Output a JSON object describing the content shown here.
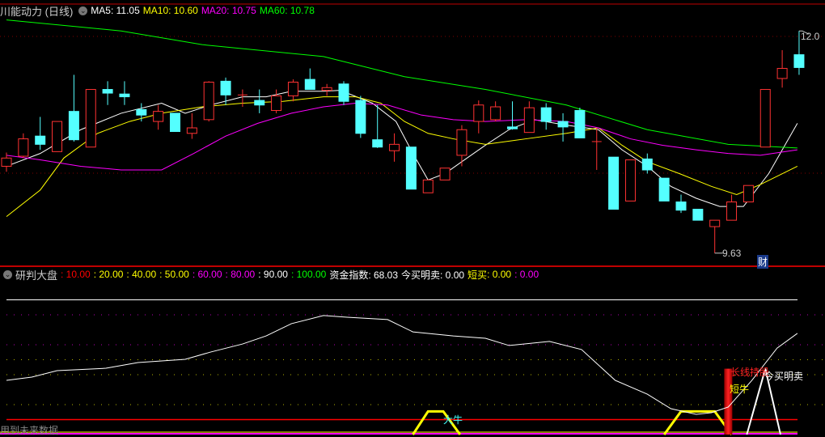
{
  "main_panel": {
    "title": "川能动力 (日线)",
    "ma": [
      {
        "label": "MA5: 11.05",
        "color": "#ffffff"
      },
      {
        "label": "MA10: 10.60",
        "color": "#ffff00"
      },
      {
        "label": "MA20: 10.75",
        "color": "#ff00ff"
      },
      {
        "label": "MA60: 10.78",
        "color": "#00ff00"
      }
    ],
    "high_label": "12.0",
    "low_label": "9.63",
    "finance_marker": "财",
    "colors": {
      "up": "#ff3232",
      "down": "#54ffff",
      "border": "#c00000"
    },
    "candles": [
      [
        10.58,
        10.67,
        10.73,
        10.52
      ],
      [
        10.69,
        10.88,
        10.94,
        10.67
      ],
      [
        10.91,
        10.82,
        11.12,
        10.76
      ],
      [
        10.74,
        11.07,
        11.07,
        10.74
      ],
      [
        11.18,
        10.87,
        11.58,
        10.85
      ],
      [
        10.79,
        11.42,
        11.42,
        10.79
      ],
      [
        11.42,
        11.38,
        11.51,
        11.25
      ],
      [
        11.37,
        11.34,
        11.51,
        11.25
      ],
      [
        11.2,
        11.14,
        11.27,
        11.07
      ],
      [
        11.07,
        11.18,
        11.25,
        10.98
      ],
      [
        11.16,
        10.96,
        11.16,
        10.96
      ],
      [
        10.94,
        11.0,
        11.16,
        10.88
      ],
      [
        11.09,
        11.5,
        11.51,
        11.07
      ],
      [
        11.51,
        11.36,
        11.55,
        11.25
      ],
      [
        11.36,
        11.36,
        11.42,
        11.23
      ],
      [
        11.3,
        11.25,
        11.42,
        11.16
      ],
      [
        11.19,
        11.35,
        11.42,
        11.16
      ],
      [
        11.35,
        11.5,
        11.53,
        11.29
      ],
      [
        11.53,
        11.42,
        11.65,
        11.42
      ],
      [
        11.41,
        11.44,
        11.48,
        11.35
      ],
      [
        11.48,
        11.29,
        11.51,
        11.25
      ],
      [
        11.3,
        10.94,
        11.35,
        10.89
      ],
      [
        10.87,
        10.79,
        11.25,
        10.78
      ],
      [
        10.75,
        10.82,
        10.94,
        10.63
      ],
      [
        10.79,
        10.33,
        10.79,
        10.33
      ],
      [
        10.29,
        10.43,
        10.43,
        10.29
      ],
      [
        10.43,
        10.56,
        10.56,
        10.43
      ],
      [
        10.7,
        10.98,
        11.03,
        10.58
      ],
      [
        11.07,
        11.25,
        11.3,
        10.94
      ],
      [
        11.09,
        11.23,
        11.29,
        11.07
      ],
      [
        11.01,
        10.99,
        11.29,
        10.98
      ],
      [
        10.95,
        11.22,
        11.29,
        10.95
      ],
      [
        11.22,
        11.07,
        11.27,
        10.98
      ],
      [
        11.07,
        11.01,
        11.16,
        10.85
      ],
      [
        11.19,
        10.89,
        11.22,
        10.89
      ],
      [
        10.85,
        10.85,
        11.0,
        10.54
      ],
      [
        10.68,
        10.11,
        10.68,
        10.11
      ],
      [
        10.2,
        10.65,
        10.65,
        10.2
      ],
      [
        10.66,
        10.54,
        10.72,
        10.5
      ],
      [
        10.45,
        10.2,
        10.45,
        10.2
      ],
      [
        10.19,
        10.1,
        10.27,
        10.07
      ],
      [
        10.11,
        9.99,
        10.11,
        9.99
      ],
      [
        9.92,
        9.99,
        9.99,
        9.63
      ],
      [
        9.99,
        10.19,
        10.27,
        9.99
      ],
      [
        10.19,
        10.37,
        10.37,
        10.19
      ],
      [
        10.79,
        11.42,
        11.42,
        10.79
      ],
      [
        11.54,
        11.65,
        11.85,
        11.44
      ],
      [
        11.8,
        11.66,
        12.06,
        11.58
      ]
    ],
    "ma_lines": {
      "ma5": [
        [
          0,
          10.58
        ],
        [
          2,
          10.72
        ],
        [
          4.4,
          10.98
        ],
        [
          6.8,
          11.16
        ],
        [
          9.2,
          11.27
        ],
        [
          10.6,
          11.16
        ],
        [
          12.1,
          11.25
        ],
        [
          14,
          11.34
        ],
        [
          15.4,
          11.34
        ],
        [
          16.9,
          11.4
        ],
        [
          18.8,
          11.4
        ],
        [
          19.8,
          11.41
        ],
        [
          21.7,
          11.27
        ],
        [
          23.1,
          11.07
        ],
        [
          24.1,
          10.72
        ],
        [
          25,
          10.43
        ],
        [
          26,
          10.5
        ],
        [
          27,
          10.63
        ],
        [
          28.4,
          10.81
        ],
        [
          29.8,
          10.98
        ],
        [
          31.3,
          11.09
        ],
        [
          33.2,
          11.03
        ],
        [
          35.1,
          10.98
        ],
        [
          36.5,
          10.76
        ],
        [
          38,
          10.58
        ],
        [
          39.4,
          10.36
        ],
        [
          40.9,
          10.23
        ],
        [
          42.3,
          10.14
        ],
        [
          43.7,
          10.14
        ],
        [
          45.2,
          10.5
        ],
        [
          46.9,
          11.05
        ]
      ],
      "ma10": [
        [
          0,
          10.03
        ],
        [
          2,
          10.32
        ],
        [
          3.4,
          10.67
        ],
        [
          5.4,
          10.94
        ],
        [
          7.3,
          11.07
        ],
        [
          9.2,
          11.16
        ],
        [
          11.6,
          11.23
        ],
        [
          14,
          11.27
        ],
        [
          16.4,
          11.29
        ],
        [
          18.8,
          11.34
        ],
        [
          20.7,
          11.34
        ],
        [
          22.2,
          11.27
        ],
        [
          23.6,
          11.07
        ],
        [
          25,
          10.94
        ],
        [
          26.5,
          10.88
        ],
        [
          28.4,
          10.82
        ],
        [
          30.8,
          10.88
        ],
        [
          33.2,
          10.94
        ],
        [
          35.1,
          11.0
        ],
        [
          36.5,
          10.81
        ],
        [
          38,
          10.63
        ],
        [
          39.9,
          10.5
        ],
        [
          41.8,
          10.36
        ],
        [
          43.3,
          10.27
        ],
        [
          44.7,
          10.38
        ],
        [
          46.9,
          10.58
        ]
      ],
      "ma20": [
        [
          0,
          10.7
        ],
        [
          2,
          10.65
        ],
        [
          4.4,
          10.58
        ],
        [
          6.8,
          10.54
        ],
        [
          9.2,
          10.54
        ],
        [
          11.1,
          10.72
        ],
        [
          13,
          10.91
        ],
        [
          14.9,
          11.05
        ],
        [
          16.9,
          11.16
        ],
        [
          18.8,
          11.23
        ],
        [
          20.7,
          11.27
        ],
        [
          22.6,
          11.25
        ],
        [
          24.6,
          11.14
        ],
        [
          26.5,
          11.09
        ],
        [
          28.4,
          11.07
        ],
        [
          30.8,
          11.09
        ],
        [
          33.2,
          11.07
        ],
        [
          35.1,
          11.0
        ],
        [
          37,
          10.88
        ],
        [
          38.9,
          10.81
        ],
        [
          40.9,
          10.76
        ],
        [
          42.8,
          10.72
        ],
        [
          44.7,
          10.7
        ],
        [
          46.9,
          10.76
        ]
      ],
      "ma60": [
        [
          0,
          12.18
        ],
        [
          6.8,
          12.06
        ],
        [
          11.6,
          11.91
        ],
        [
          18.8,
          11.78
        ],
        [
          23.6,
          11.56
        ],
        [
          28.4,
          11.42
        ],
        [
          33.2,
          11.25
        ],
        [
          38,
          10.98
        ],
        [
          42.8,
          10.82
        ],
        [
          46.9,
          10.78
        ]
      ]
    }
  },
  "indicator_panel": {
    "title": "研判大盘",
    "levels": [
      {
        "label": ": 10.00",
        "value": 10,
        "color": "#ff0000"
      },
      {
        "label": ": 20.00",
        "value": 20,
        "color": "#ffff00"
      },
      {
        "label": ": 40.00",
        "value": 40,
        "color": "#ffff00"
      },
      {
        "label": ": 50.00",
        "value": 50,
        "color": "#ffff00"
      },
      {
        "label": ": 60.00",
        "value": 60,
        "color": "#ff00ff"
      },
      {
        "label": ": 80.00",
        "value": 80,
        "color": "#ff00ff"
      },
      {
        "label": ": 90.00",
        "value": 90,
        "color": "#ffffff"
      },
      {
        "label": ": 100.00",
        "value": 100,
        "color": "#00ff00"
      }
    ],
    "fund_index_label": "资金指数: 68.03",
    "buy_sell_label": "今买明卖: 0.00",
    "short_buy_label": "短买",
    "short_buy_value": ": 0.00",
    "last_value": ": 0.00",
    "fund_index_line": [
      [
        0,
        36.2
      ],
      [
        1.5,
        38.4
      ],
      [
        3,
        42.7
      ],
      [
        5.9,
        44.3
      ],
      [
        7.8,
        48.1
      ],
      [
        10.6,
        50.3
      ],
      [
        12.1,
        55.1
      ],
      [
        14,
        60.5
      ],
      [
        15.4,
        65.9
      ],
      [
        16.9,
        74.1
      ],
      [
        18.8,
        79.5
      ],
      [
        20.2,
        78.4
      ],
      [
        22.6,
        76.8
      ],
      [
        24.1,
        68.6
      ],
      [
        26.5,
        65.9
      ],
      [
        28.4,
        64.3
      ],
      [
        29.8,
        59.5
      ],
      [
        32.2,
        62.2
      ],
      [
        34.1,
        56.8
      ],
      [
        36.1,
        36.2
      ],
      [
        38,
        27
      ],
      [
        39.4,
        17.3
      ],
      [
        40.9,
        13.5
      ],
      [
        41.8,
        14.6
      ],
      [
        42.8,
        18.4
      ],
      [
        44.2,
        36.2
      ],
      [
        45.7,
        57.8
      ],
      [
        46.9,
        67.6
      ]
    ],
    "big_bull_signals": [
      [
        24.1,
        25,
        25.9,
        26.9
      ],
      [
        39,
        40,
        42,
        43
      ]
    ],
    "big_bull_level": 15.5,
    "long_hold_bar": {
      "index": 42.8,
      "value": 44
    },
    "buy_sell_triangle": {
      "start": 43.9,
      "peak": 45,
      "end": 45.9,
      "value": 44
    },
    "labels": {
      "big_bull": "大牛",
      "short_bull": "短牛",
      "long_hold": "长线持股",
      "buy_sell": "今买明卖"
    },
    "warning": "用到未来数据"
  }
}
